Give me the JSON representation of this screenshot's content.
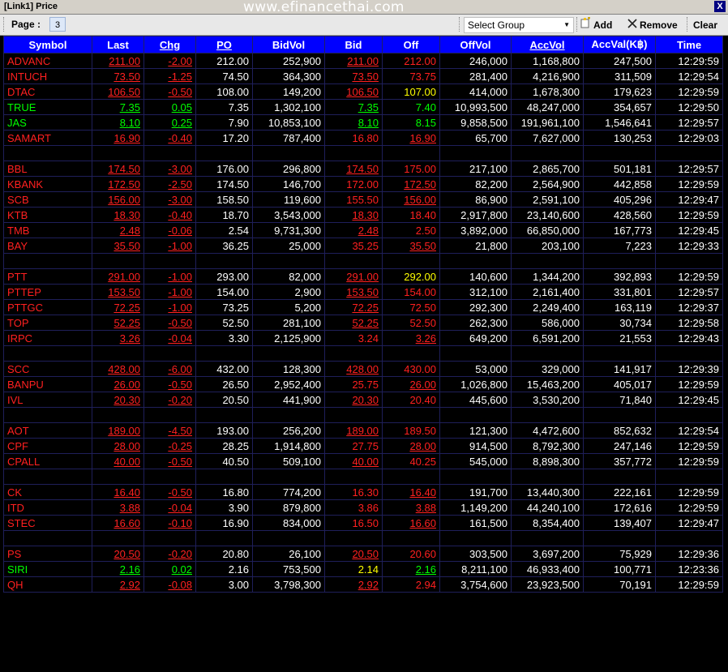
{
  "window": {
    "title": "[Link1] Price",
    "watermark": "www.efinancethai.com",
    "close_label": "X"
  },
  "toolbar": {
    "page_label": "Page :",
    "page_value": "3",
    "select_group_value": "Select Group",
    "add_label": "Add",
    "remove_label": "Remove",
    "clear_label": "Clear"
  },
  "colors": {
    "red": "#ff2020",
    "green": "#00ff00",
    "yellow": "#ffff00",
    "white": "#ffffff",
    "header_bg": "#0000ff"
  },
  "columns": [
    {
      "label": "Symbol",
      "underline": false
    },
    {
      "label": "Last",
      "underline": false
    },
    {
      "label": "Chg",
      "underline": true
    },
    {
      "label": "PO",
      "underline": true
    },
    {
      "label": "BidVol",
      "underline": false
    },
    {
      "label": "Bid",
      "underline": false
    },
    {
      "label": "Off",
      "underline": false
    },
    {
      "label": "OffVol",
      "underline": false
    },
    {
      "label": "AccVol",
      "underline": true
    },
    {
      "label": "AccVal(K฿)",
      "underline": false
    },
    {
      "label": "Time",
      "underline": false
    }
  ],
  "rows": [
    {
      "symbol": "ADVANC",
      "last": "211.00",
      "chg": "-2.00",
      "po": "212.00",
      "bidvol": "252,900",
      "bid": "211.00",
      "off": "212.00",
      "offvol": "246,000",
      "accvol": "1,168,800",
      "accval": "247,500",
      "time": "12:29:59",
      "c": [
        "red",
        "red",
        "red",
        "white",
        "white",
        "red",
        "red",
        "white",
        "white",
        "white",
        "white"
      ],
      "u": [
        0,
        1,
        1,
        0,
        0,
        1,
        0,
        0,
        0,
        0,
        0
      ]
    },
    {
      "symbol": "INTUCH",
      "last": "73.50",
      "chg": "-1.25",
      "po": "74.50",
      "bidvol": "364,300",
      "bid": "73.50",
      "off": "73.75",
      "offvol": "281,400",
      "accvol": "4,216,900",
      "accval": "311,509",
      "time": "12:29:54",
      "c": [
        "red",
        "red",
        "red",
        "white",
        "white",
        "red",
        "red",
        "white",
        "white",
        "white",
        "white"
      ],
      "u": [
        0,
        1,
        1,
        0,
        0,
        1,
        0,
        0,
        0,
        0,
        0
      ]
    },
    {
      "symbol": "DTAC",
      "last": "106.50",
      "chg": "-0.50",
      "po": "108.00",
      "bidvol": "149,200",
      "bid": "106.50",
      "off": "107.00",
      "offvol": "414,000",
      "accvol": "1,678,300",
      "accval": "179,623",
      "time": "12:29:59",
      "c": [
        "red",
        "red",
        "red",
        "white",
        "white",
        "red",
        "yellow",
        "white",
        "white",
        "white",
        "white"
      ],
      "u": [
        0,
        1,
        1,
        0,
        0,
        1,
        0,
        0,
        0,
        0,
        0
      ]
    },
    {
      "symbol": "TRUE",
      "last": "7.35",
      "chg": "0.05",
      "po": "7.35",
      "bidvol": "1,302,100",
      "bid": "7.35",
      "off": "7.40",
      "offvol": "10,993,500",
      "accvol": "48,247,000",
      "accval": "354,657",
      "time": "12:29:50",
      "c": [
        "green",
        "green",
        "green",
        "white",
        "white",
        "green",
        "green",
        "white",
        "white",
        "white",
        "white"
      ],
      "u": [
        0,
        1,
        1,
        0,
        0,
        1,
        0,
        0,
        0,
        0,
        0
      ]
    },
    {
      "symbol": "JAS",
      "last": "8.10",
      "chg": "0.25",
      "po": "7.90",
      "bidvol": "10,853,100",
      "bid": "8.10",
      "off": "8.15",
      "offvol": "9,858,500",
      "accvol": "191,961,100",
      "accval": "1,546,641",
      "time": "12:29:57",
      "c": [
        "green",
        "green",
        "green",
        "white",
        "white",
        "green",
        "green",
        "white",
        "white",
        "white",
        "white"
      ],
      "u": [
        0,
        1,
        1,
        0,
        0,
        1,
        0,
        0,
        0,
        0,
        0
      ]
    },
    {
      "symbol": "SAMART",
      "last": "16.90",
      "chg": "-0.40",
      "po": "17.20",
      "bidvol": "787,400",
      "bid": "16.80",
      "off": "16.90",
      "offvol": "65,700",
      "accvol": "7,627,000",
      "accval": "130,253",
      "time": "12:29:03",
      "c": [
        "red",
        "red",
        "red",
        "white",
        "white",
        "red",
        "red",
        "white",
        "white",
        "white",
        "white"
      ],
      "u": [
        0,
        1,
        1,
        0,
        0,
        0,
        1,
        0,
        0,
        0,
        0
      ]
    },
    {
      "blank": true
    },
    {
      "symbol": "BBL",
      "last": "174.50",
      "chg": "-3.00",
      "po": "176.00",
      "bidvol": "296,800",
      "bid": "174.50",
      "off": "175.00",
      "offvol": "217,100",
      "accvol": "2,865,700",
      "accval": "501,181",
      "time": "12:29:57",
      "c": [
        "red",
        "red",
        "red",
        "white",
        "white",
        "red",
        "red",
        "white",
        "white",
        "white",
        "white"
      ],
      "u": [
        0,
        1,
        1,
        0,
        0,
        1,
        0,
        0,
        0,
        0,
        0
      ]
    },
    {
      "symbol": "KBANK",
      "last": "172.50",
      "chg": "-2.50",
      "po": "174.50",
      "bidvol": "146,700",
      "bid": "172.00",
      "off": "172.50",
      "offvol": "82,200",
      "accvol": "2,564,900",
      "accval": "442,858",
      "time": "12:29:59",
      "c": [
        "red",
        "red",
        "red",
        "white",
        "white",
        "red",
        "red",
        "white",
        "white",
        "white",
        "white"
      ],
      "u": [
        0,
        1,
        1,
        0,
        0,
        0,
        1,
        0,
        0,
        0,
        0
      ]
    },
    {
      "symbol": "SCB",
      "last": "156.00",
      "chg": "-3.00",
      "po": "158.50",
      "bidvol": "119,600",
      "bid": "155.50",
      "off": "156.00",
      "offvol": "86,900",
      "accvol": "2,591,100",
      "accval": "405,296",
      "time": "12:29:47",
      "c": [
        "red",
        "red",
        "red",
        "white",
        "white",
        "red",
        "red",
        "white",
        "white",
        "white",
        "white"
      ],
      "u": [
        0,
        1,
        1,
        0,
        0,
        0,
        1,
        0,
        0,
        0,
        0
      ]
    },
    {
      "symbol": "KTB",
      "last": "18.30",
      "chg": "-0.40",
      "po": "18.70",
      "bidvol": "3,543,000",
      "bid": "18.30",
      "off": "18.40",
      "offvol": "2,917,800",
      "accvol": "23,140,600",
      "accval": "428,560",
      "time": "12:29:59",
      "c": [
        "red",
        "red",
        "red",
        "white",
        "white",
        "red",
        "red",
        "white",
        "white",
        "white",
        "white"
      ],
      "u": [
        0,
        1,
        1,
        0,
        0,
        1,
        0,
        0,
        0,
        0,
        0
      ]
    },
    {
      "symbol": "TMB",
      "last": "2.48",
      "chg": "-0.06",
      "po": "2.54",
      "bidvol": "9,731,300",
      "bid": "2.48",
      "off": "2.50",
      "offvol": "3,892,000",
      "accvol": "66,850,000",
      "accval": "167,773",
      "time": "12:29:45",
      "c": [
        "red",
        "red",
        "red",
        "white",
        "white",
        "red",
        "red",
        "white",
        "white",
        "white",
        "white"
      ],
      "u": [
        0,
        1,
        1,
        0,
        0,
        1,
        0,
        0,
        0,
        0,
        0
      ]
    },
    {
      "symbol": "BAY",
      "last": "35.50",
      "chg": "-1.00",
      "po": "36.25",
      "bidvol": "25,000",
      "bid": "35.25",
      "off": "35.50",
      "offvol": "21,800",
      "accvol": "203,100",
      "accval": "7,223",
      "time": "12:29:33",
      "c": [
        "red",
        "red",
        "red",
        "white",
        "white",
        "red",
        "red",
        "white",
        "white",
        "white",
        "white"
      ],
      "u": [
        0,
        1,
        1,
        0,
        0,
        0,
        1,
        0,
        0,
        0,
        0
      ]
    },
    {
      "blank": true
    },
    {
      "symbol": "PTT",
      "last": "291.00",
      "chg": "-1.00",
      "po": "293.00",
      "bidvol": "82,000",
      "bid": "291.00",
      "off": "292.00",
      "offvol": "140,600",
      "accvol": "1,344,200",
      "accval": "392,893",
      "time": "12:29:59",
      "c": [
        "red",
        "red",
        "red",
        "white",
        "white",
        "red",
        "yellow",
        "white",
        "white",
        "white",
        "white"
      ],
      "u": [
        0,
        1,
        1,
        0,
        0,
        1,
        0,
        0,
        0,
        0,
        0
      ]
    },
    {
      "symbol": "PTTEP",
      "last": "153.50",
      "chg": "-1.00",
      "po": "154.00",
      "bidvol": "2,900",
      "bid": "153.50",
      "off": "154.00",
      "offvol": "312,100",
      "accvol": "2,161,400",
      "accval": "331,801",
      "time": "12:29:57",
      "c": [
        "red",
        "red",
        "red",
        "white",
        "white",
        "red",
        "red",
        "white",
        "white",
        "white",
        "white"
      ],
      "u": [
        0,
        1,
        1,
        0,
        0,
        1,
        0,
        0,
        0,
        0,
        0
      ]
    },
    {
      "symbol": "PTTGC",
      "last": "72.25",
      "chg": "-1.00",
      "po": "73.25",
      "bidvol": "5,200",
      "bid": "72.25",
      "off": "72.50",
      "offvol": "292,300",
      "accvol": "2,249,400",
      "accval": "163,119",
      "time": "12:29:37",
      "c": [
        "red",
        "red",
        "red",
        "white",
        "white",
        "red",
        "red",
        "white",
        "white",
        "white",
        "white"
      ],
      "u": [
        0,
        1,
        1,
        0,
        0,
        1,
        0,
        0,
        0,
        0,
        0
      ]
    },
    {
      "symbol": "TOP",
      "last": "52.25",
      "chg": "-0.50",
      "po": "52.50",
      "bidvol": "281,100",
      "bid": "52.25",
      "off": "52.50",
      "offvol": "262,300",
      "accvol": "586,000",
      "accval": "30,734",
      "time": "12:29:58",
      "c": [
        "red",
        "red",
        "red",
        "white",
        "white",
        "red",
        "red",
        "white",
        "white",
        "white",
        "white"
      ],
      "u": [
        0,
        1,
        1,
        0,
        0,
        1,
        0,
        0,
        0,
        0,
        0
      ]
    },
    {
      "symbol": "IRPC",
      "last": "3.26",
      "chg": "-0.04",
      "po": "3.30",
      "bidvol": "2,125,900",
      "bid": "3.24",
      "off": "3.26",
      "offvol": "649,200",
      "accvol": "6,591,200",
      "accval": "21,553",
      "time": "12:29:43",
      "c": [
        "red",
        "red",
        "red",
        "white",
        "white",
        "red",
        "red",
        "white",
        "white",
        "white",
        "white"
      ],
      "u": [
        0,
        1,
        1,
        0,
        0,
        0,
        1,
        0,
        0,
        0,
        0
      ]
    },
    {
      "blank": true
    },
    {
      "symbol": "SCC",
      "last": "428.00",
      "chg": "-6.00",
      "po": "432.00",
      "bidvol": "128,300",
      "bid": "428.00",
      "off": "430.00",
      "offvol": "53,000",
      "accvol": "329,000",
      "accval": "141,917",
      "time": "12:29:39",
      "c": [
        "red",
        "red",
        "red",
        "white",
        "white",
        "red",
        "red",
        "white",
        "white",
        "white",
        "white"
      ],
      "u": [
        0,
        1,
        1,
        0,
        0,
        1,
        0,
        0,
        0,
        0,
        0
      ]
    },
    {
      "symbol": "BANPU",
      "last": "26.00",
      "chg": "-0.50",
      "po": "26.50",
      "bidvol": "2,952,400",
      "bid": "25.75",
      "off": "26.00",
      "offvol": "1,026,800",
      "accvol": "15,463,200",
      "accval": "405,017",
      "time": "12:29:59",
      "c": [
        "red",
        "red",
        "red",
        "white",
        "white",
        "red",
        "red",
        "white",
        "white",
        "white",
        "white"
      ],
      "u": [
        0,
        1,
        1,
        0,
        0,
        0,
        1,
        0,
        0,
        0,
        0
      ]
    },
    {
      "symbol": "IVL",
      "last": "20.30",
      "chg": "-0.20",
      "po": "20.50",
      "bidvol": "441,900",
      "bid": "20.30",
      "off": "20.40",
      "offvol": "445,600",
      "accvol": "3,530,200",
      "accval": "71,840",
      "time": "12:29:45",
      "c": [
        "red",
        "red",
        "red",
        "white",
        "white",
        "red",
        "red",
        "white",
        "white",
        "white",
        "white"
      ],
      "u": [
        0,
        1,
        1,
        0,
        0,
        1,
        0,
        0,
        0,
        0,
        0
      ]
    },
    {
      "blank": true
    },
    {
      "symbol": "AOT",
      "last": "189.00",
      "chg": "-4.50",
      "po": "193.00",
      "bidvol": "256,200",
      "bid": "189.00",
      "off": "189.50",
      "offvol": "121,300",
      "accvol": "4,472,600",
      "accval": "852,632",
      "time": "12:29:54",
      "c": [
        "red",
        "red",
        "red",
        "white",
        "white",
        "red",
        "red",
        "white",
        "white",
        "white",
        "white"
      ],
      "u": [
        0,
        1,
        1,
        0,
        0,
        1,
        0,
        0,
        0,
        0,
        0
      ]
    },
    {
      "symbol": "CPF",
      "last": "28.00",
      "chg": "-0.25",
      "po": "28.25",
      "bidvol": "1,914,800",
      "bid": "27.75",
      "off": "28.00",
      "offvol": "914,500",
      "accvol": "8,792,300",
      "accval": "247,146",
      "time": "12:29:59",
      "c": [
        "red",
        "red",
        "red",
        "white",
        "white",
        "red",
        "red",
        "white",
        "white",
        "white",
        "white"
      ],
      "u": [
        0,
        1,
        1,
        0,
        0,
        0,
        1,
        0,
        0,
        0,
        0
      ]
    },
    {
      "symbol": "CPALL",
      "last": "40.00",
      "chg": "-0.50",
      "po": "40.50",
      "bidvol": "509,100",
      "bid": "40.00",
      "off": "40.25",
      "offvol": "545,000",
      "accvol": "8,898,300",
      "accval": "357,772",
      "time": "12:29:59",
      "c": [
        "red",
        "red",
        "red",
        "white",
        "white",
        "red",
        "red",
        "white",
        "white",
        "white",
        "white"
      ],
      "u": [
        0,
        1,
        1,
        0,
        0,
        1,
        0,
        0,
        0,
        0,
        0
      ]
    },
    {
      "blank": true
    },
    {
      "symbol": "CK",
      "last": "16.40",
      "chg": "-0.50",
      "po": "16.80",
      "bidvol": "774,200",
      "bid": "16.30",
      "off": "16.40",
      "offvol": "191,700",
      "accvol": "13,440,300",
      "accval": "222,161",
      "time": "12:29:59",
      "c": [
        "red",
        "red",
        "red",
        "white",
        "white",
        "red",
        "red",
        "white",
        "white",
        "white",
        "white"
      ],
      "u": [
        0,
        1,
        1,
        0,
        0,
        0,
        1,
        0,
        0,
        0,
        0
      ]
    },
    {
      "symbol": "ITD",
      "last": "3.88",
      "chg": "-0.04",
      "po": "3.90",
      "bidvol": "879,800",
      "bid": "3.86",
      "off": "3.88",
      "offvol": "1,149,200",
      "accvol": "44,240,100",
      "accval": "172,616",
      "time": "12:29:59",
      "c": [
        "red",
        "red",
        "red",
        "white",
        "white",
        "red",
        "red",
        "white",
        "white",
        "white",
        "white"
      ],
      "u": [
        0,
        1,
        1,
        0,
        0,
        0,
        1,
        0,
        0,
        0,
        0
      ]
    },
    {
      "symbol": "STEC",
      "last": "16.60",
      "chg": "-0.10",
      "po": "16.90",
      "bidvol": "834,000",
      "bid": "16.50",
      "off": "16.60",
      "offvol": "161,500",
      "accvol": "8,354,400",
      "accval": "139,407",
      "time": "12:29:47",
      "c": [
        "red",
        "red",
        "red",
        "white",
        "white",
        "red",
        "red",
        "white",
        "white",
        "white",
        "white"
      ],
      "u": [
        0,
        1,
        1,
        0,
        0,
        0,
        1,
        0,
        0,
        0,
        0
      ]
    },
    {
      "blank": true
    },
    {
      "symbol": "PS",
      "last": "20.50",
      "chg": "-0.20",
      "po": "20.80",
      "bidvol": "26,100",
      "bid": "20.50",
      "off": "20.60",
      "offvol": "303,500",
      "accvol": "3,697,200",
      "accval": "75,929",
      "time": "12:29:36",
      "c": [
        "red",
        "red",
        "red",
        "white",
        "white",
        "red",
        "red",
        "white",
        "white",
        "white",
        "white"
      ],
      "u": [
        0,
        1,
        1,
        0,
        0,
        1,
        0,
        0,
        0,
        0,
        0
      ]
    },
    {
      "symbol": "SIRI",
      "last": "2.16",
      "chg": "0.02",
      "po": "2.16",
      "bidvol": "753,500",
      "bid": "2.14",
      "off": "2.16",
      "offvol": "8,211,100",
      "accvol": "46,933,400",
      "accval": "100,771",
      "time": "12:23:36",
      "c": [
        "green",
        "green",
        "green",
        "white",
        "white",
        "yellow",
        "green",
        "white",
        "white",
        "white",
        "white"
      ],
      "u": [
        0,
        1,
        1,
        0,
        0,
        0,
        1,
        0,
        0,
        0,
        0
      ]
    },
    {
      "symbol": "QH",
      "last": "2.92",
      "chg": "-0.08",
      "po": "3.00",
      "bidvol": "3,798,300",
      "bid": "2.92",
      "off": "2.94",
      "offvol": "3,754,600",
      "accvol": "23,923,500",
      "accval": "70,191",
      "time": "12:29:59",
      "c": [
        "red",
        "red",
        "red",
        "white",
        "white",
        "red",
        "red",
        "white",
        "white",
        "white",
        "white"
      ],
      "u": [
        0,
        1,
        1,
        0,
        0,
        1,
        0,
        0,
        0,
        0,
        0
      ]
    }
  ]
}
